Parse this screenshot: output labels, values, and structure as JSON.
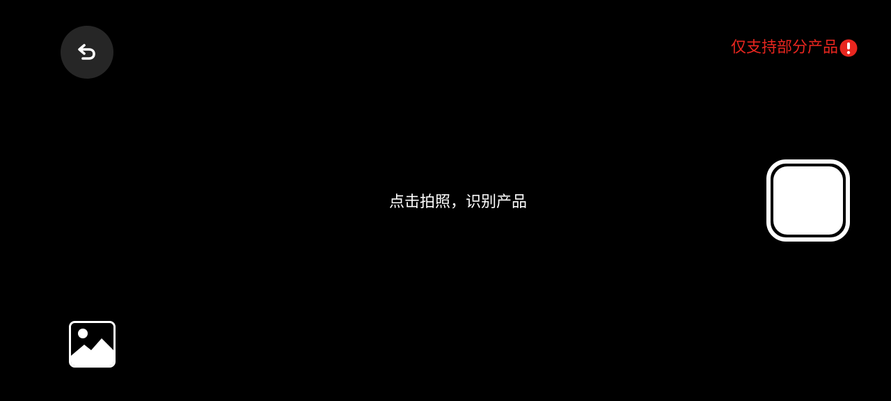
{
  "header": {
    "back_icon": "back-arrow-icon",
    "notice_text": "仅支持部分产品",
    "notice_icon": "exclamation-circle-icon",
    "notice_color": "#e8261f"
  },
  "viewfinder": {
    "hint_text": "点击拍照，识别产品"
  },
  "controls": {
    "shutter_icon": "shutter-button-icon",
    "gallery_icon": "image-gallery-icon"
  },
  "colors": {
    "background": "#000000",
    "accent_warning": "#e8261f",
    "foreground": "#ffffff",
    "button_bg": "#262626"
  }
}
